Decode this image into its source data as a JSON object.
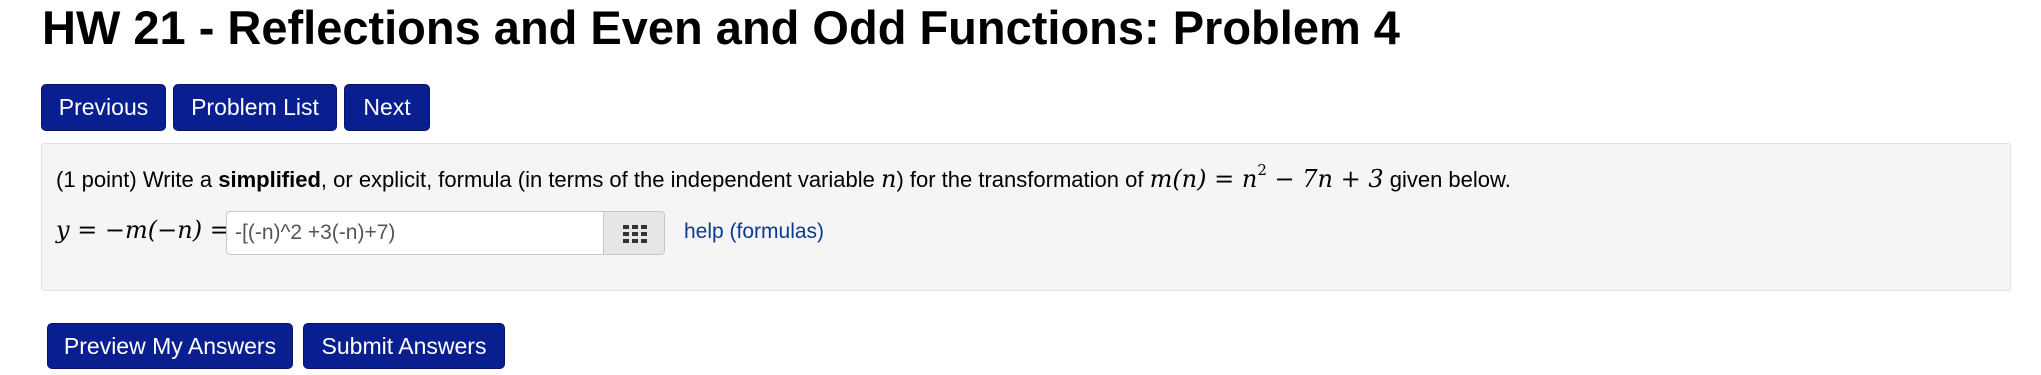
{
  "page": {
    "title": "HW 21 - Reflections and Even and Odd Functions: Problem 4"
  },
  "nav": {
    "previous_label": "Previous",
    "problem_list_label": "Problem List",
    "next_label": "Next"
  },
  "problem": {
    "points": "(1 point)",
    "text_1": " Write a ",
    "text_bold": "simplified",
    "text_2": ", or explicit, formula (in terms of the independent variable ",
    "variable": "n",
    "text_3": ") for the transformation of ",
    "function_lhs": "m(n) = n",
    "function_exponent": "2",
    "function_rhs": " − 7n + 3",
    "text_4": " given below.",
    "answer_label": "y = −m(−n) =",
    "answer_value": "-[(-n)^2 +3(-n)+7)",
    "palette_icon": "keypad-icon",
    "help_label": "help (formulas)"
  },
  "actions": {
    "preview_label": "Preview My Answers",
    "submit_label": "Submit Answers"
  },
  "colors": {
    "button_bg": "#0a1f8f",
    "link": "#0b3a8f",
    "panel_bg": "#f5f5f5"
  }
}
